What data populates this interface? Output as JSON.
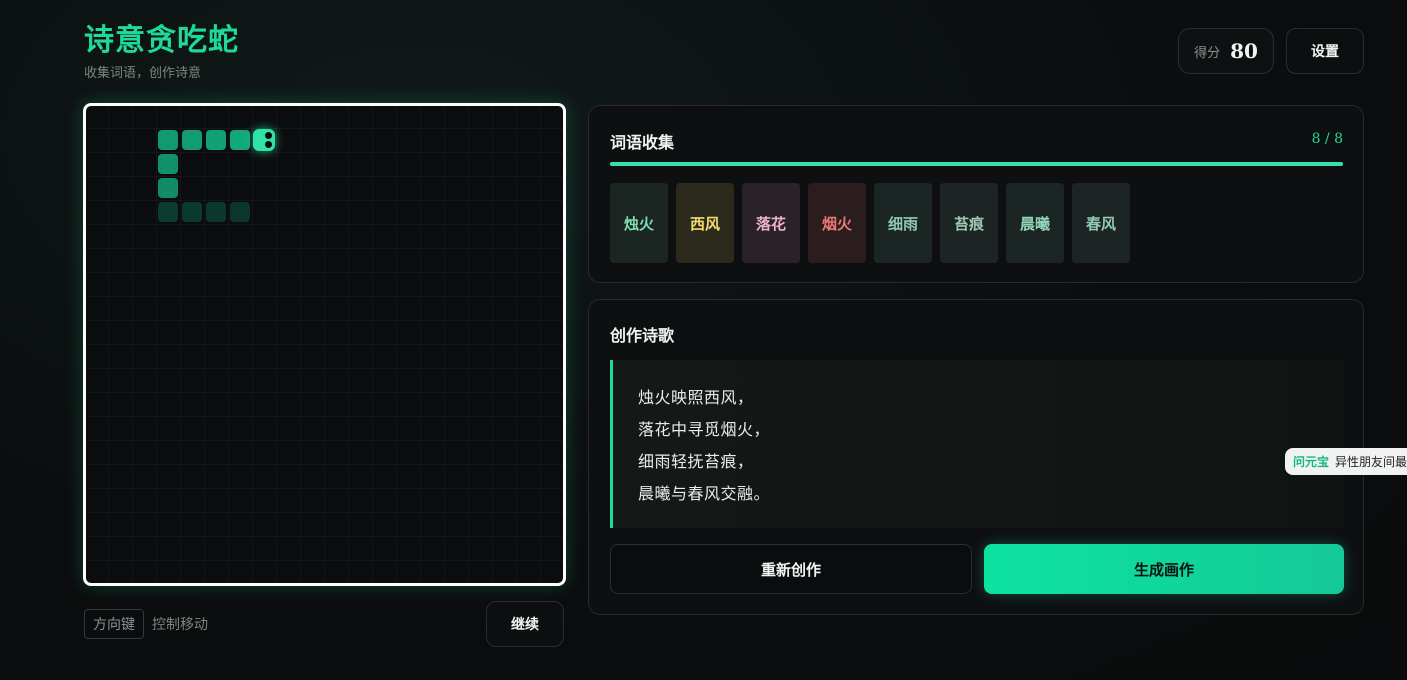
{
  "header": {
    "title": "诗意贪吃蛇",
    "subtitle": "收集词语，创作诗意"
  },
  "score": {
    "label": "得分",
    "value": "80"
  },
  "settings_label": "设置",
  "snake": {
    "cell_count": 20,
    "head": {
      "col": 7,
      "row": 1,
      "direction": "right"
    },
    "body": [
      [
        6,
        1
      ],
      [
        5,
        1
      ],
      [
        4,
        1
      ],
      [
        3,
        1
      ],
      [
        3,
        2
      ],
      [
        3,
        3
      ],
      [
        3,
        4
      ],
      [
        4,
        4
      ],
      [
        5,
        4
      ],
      [
        6,
        4
      ]
    ],
    "colors": {
      "head": "#2ee3a5",
      "body_bright": "#12a87a",
      "body_dim": "#0a4a39"
    }
  },
  "controls": {
    "key_label": "方向键",
    "hint": "控制移动",
    "continue_label": "继续"
  },
  "words_panel": {
    "title": "词语收集",
    "count": "8 / 8",
    "progress": 1.0,
    "words": [
      {
        "text": "烛火",
        "color": "#7fdbb0",
        "bg": "#1b2623"
      },
      {
        "text": "西风",
        "color": "#f3da6e",
        "bg": "#2c2a1c"
      },
      {
        "text": "落花",
        "color": "#ecb3c8",
        "bg": "#2a2226"
      },
      {
        "text": "烟火",
        "color": "#e67a73",
        "bg": "#2b1d1e"
      },
      {
        "text": "细雨",
        "color": "#8fc9b2",
        "bg": "#1b2523"
      },
      {
        "text": "苔痕",
        "color": "#9fc7b0",
        "bg": "#1c2523"
      },
      {
        "text": "晨曦",
        "color": "#93d4b8",
        "bg": "#1b2523"
      },
      {
        "text": "春风",
        "color": "#8fcab3",
        "bg": "#1c2523"
      }
    ]
  },
  "poem_panel": {
    "title": "创作诗歌",
    "lines": [
      "烛火映照西风，",
      "落花中寻觅烟火，",
      "细雨轻抚苔痕，",
      "晨曦与春风交融。"
    ],
    "rewrite_label": "重新创作",
    "generate_label": "生成画作"
  },
  "floating_tab": {
    "brand": "问元宝",
    "text": "异性朋友间最"
  }
}
